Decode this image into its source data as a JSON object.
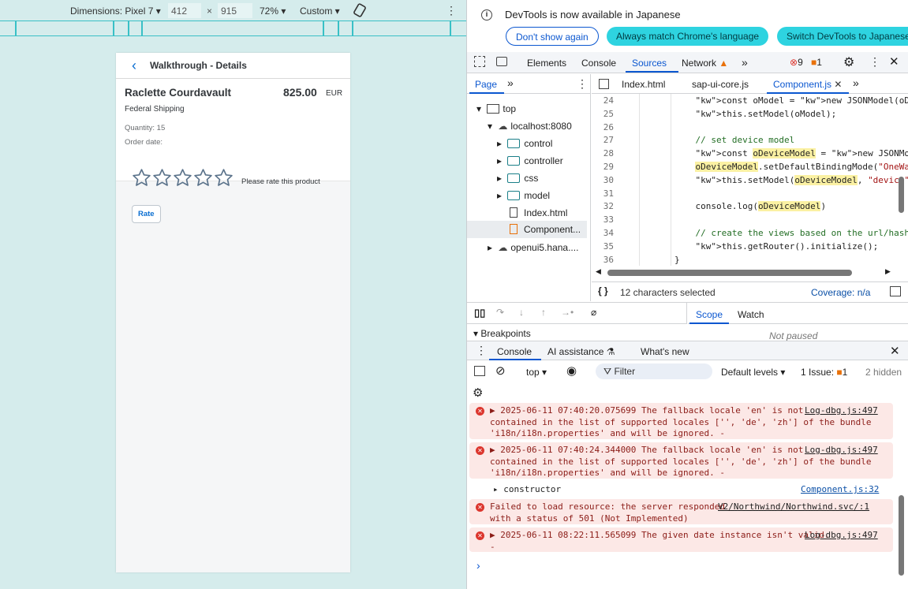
{
  "device_toolbar": {
    "dimensions_label": "Dimensions: Pixel 7",
    "width": "412",
    "height": "915",
    "separator": "×",
    "zoom": "72%",
    "throttle": "Custom"
  },
  "app": {
    "back_label": "‹",
    "title": "Walkthrough - Details",
    "product_name": "Raclette Courdavault",
    "price": "825.00",
    "currency": "EUR",
    "supplier": "Federal Shipping",
    "quantity_label": "Quantity: 15",
    "order_date_label": "Order date:",
    "rating_hint": "Please rate this product",
    "rate_button": "Rate",
    "stars": 5,
    "rating_value": 0
  },
  "infobar": {
    "message": "DevTools is now available in Japanese",
    "btn_dont_show": "Don't show again",
    "btn_match": "Always match Chrome's language",
    "btn_switch": "Switch DevTools to Japanese"
  },
  "main_tabs": {
    "elements": "Elements",
    "console": "Console",
    "sources": "Sources",
    "network": "Network",
    "errors": "9",
    "warnings": "1"
  },
  "sources": {
    "left_tab": "Page",
    "file_tabs": [
      "Index.html",
      "sap-ui-core.js",
      "Component.js"
    ],
    "status": "12 characters selected",
    "coverage": "Coverage: n/a"
  },
  "tree": {
    "top": "top",
    "host": "localhost:8080",
    "folders": [
      "control",
      "controller",
      "css",
      "model"
    ],
    "files": [
      "Index.html",
      "Component..."
    ],
    "cdn": "openui5.hana...."
  },
  "code": {
    "lines": [
      {
        "n": "24",
        "t": "            const oModel = new JSONModel(oData);"
      },
      {
        "n": "25",
        "t": "            this.setModel(oModel);"
      },
      {
        "n": "26",
        "t": ""
      },
      {
        "n": "27",
        "t": "            // set device model"
      },
      {
        "n": "28",
        "t": "            const oDeviceModel = new JSONModel(Device)"
      },
      {
        "n": "29",
        "t": "            oDeviceModel.setDefaultBindingMode(\"OneWay\""
      },
      {
        "n": "30",
        "t": "            this.setModel(oDeviceModel, \"device\");"
      },
      {
        "n": "31",
        "t": ""
      },
      {
        "n": "32",
        "t": "            console.log(oDeviceModel)"
      },
      {
        "n": "33",
        "t": ""
      },
      {
        "n": "34",
        "t": "            // create the views based on the url/hash"
      },
      {
        "n": "35",
        "t": "            this.getRouter().initialize();"
      },
      {
        "n": "36",
        "t": "        }"
      }
    ]
  },
  "debugger": {
    "breakpoints": "Breakpoints",
    "scope": "Scope",
    "watch": "Watch",
    "not_paused": "Not paused"
  },
  "drawer": {
    "tab_console": "Console",
    "tab_ai": "AI assistance",
    "tab_whats_new": "What's new",
    "context": "top",
    "filter_placeholder": "Filter",
    "levels": "Default levels",
    "issues_label": "1 Issue:",
    "issues_count": "1",
    "hidden": "2 hidden"
  },
  "console_messages": [
    {
      "type": "error",
      "text": "▶ 2025-06-11 07:40:20.075699 The fallback locale 'en' is not\ncontained in the list of supported locales ['', 'de', 'zh'] of the bundle\n'i18n/i18n.properties' and will be ignored. -",
      "link": "Log-dbg.js:497"
    },
    {
      "type": "error",
      "text": "▶ 2025-06-11 07:40:24.344000 The fallback locale 'en' is not\ncontained in the list of supported locales ['', 'de', 'zh'] of the bundle\n'i18n/i18n.properties' and will be ignored. -",
      "link": "Log-dbg.js:497"
    },
    {
      "type": "log",
      "text": "▸ constructor",
      "link": "Component.js:32"
    },
    {
      "type": "error",
      "text": "Failed to load resource: the server responded\nwith a status of 501 (Not Implemented)",
      "link": "V2/Northwind/Northwind.svc/:1"
    },
    {
      "type": "error",
      "text": "▶ 2025-06-11 08:22:11.565099 The given date instance isn't valid.\n-",
      "link": "Log-dbg.js:497"
    }
  ],
  "prompt": "›"
}
